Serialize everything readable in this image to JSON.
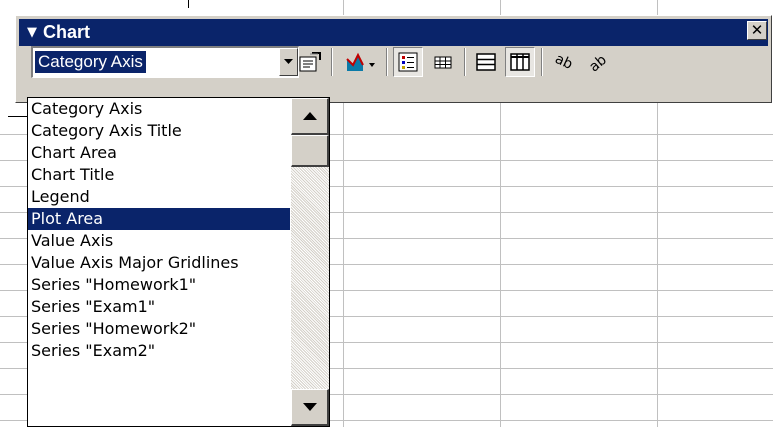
{
  "toolbar": {
    "title": "Chart",
    "close_glyph": "✕",
    "selected_object": "Category Axis",
    "buttons": [
      {
        "name": "format-selected-object-icon"
      },
      {
        "name": "chart-type-icon"
      },
      {
        "name": "legend-icon"
      },
      {
        "name": "data-table-icon"
      },
      {
        "name": "by-row-icon"
      },
      {
        "name": "by-column-icon"
      },
      {
        "name": "angle-text-downward-icon"
      },
      {
        "name": "angle-text-upward-icon"
      }
    ]
  },
  "dropdown": {
    "items": [
      "Category Axis",
      "Category Axis Title",
      "Chart Area",
      "Chart Title",
      "Legend",
      "Plot Area",
      "Value Axis",
      "Value Axis Major Gridlines",
      "Series \"Homework1\"",
      "Series \"Exam1\"",
      "Series \"Homework2\"",
      "Series \"Exam2\""
    ],
    "selected_index": 5
  },
  "colors": {
    "title_bar": "#0a246a",
    "face": "#d4d0c8",
    "selection": "#0a246a"
  }
}
